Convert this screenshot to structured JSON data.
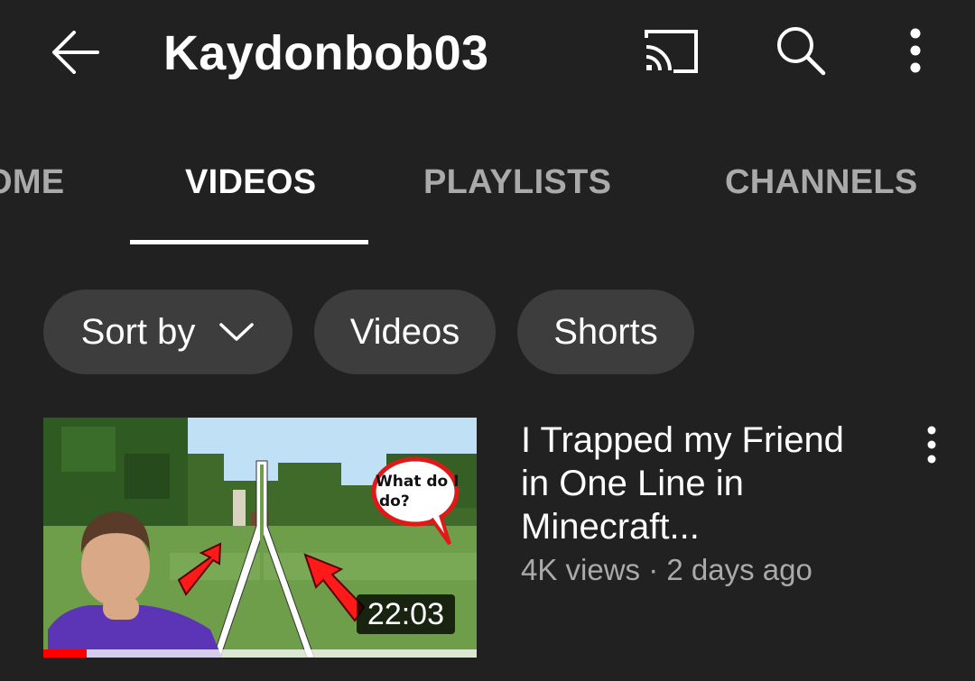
{
  "header": {
    "title": "Kaydonbob03",
    "icons": [
      "arrow-back-icon",
      "cast-icon",
      "search-icon",
      "more-vert-icon"
    ]
  },
  "tabs": [
    {
      "label": "HOME",
      "visible_text": "OME",
      "active": false
    },
    {
      "label": "VIDEOS",
      "active": true
    },
    {
      "label": "PLAYLISTS",
      "active": false
    },
    {
      "label": "CHANNELS",
      "active": false
    }
  ],
  "chips": {
    "sort_label": "Sort by",
    "videos_label": "Videos",
    "shorts_label": "Shorts"
  },
  "video": {
    "title": "I Trapped my Friend in One Line in Minecraft...",
    "meta": "4K views · 2 days ago",
    "duration": "22:03",
    "watch_progress": 0.1,
    "thumbnail_text": "What do I do?"
  },
  "colors": {
    "background": "#212121",
    "chip_background": "#3d3d3d",
    "text_primary": "#ffffff",
    "text_secondary": "#aaaaaa",
    "progress_red": "#ff0000"
  }
}
